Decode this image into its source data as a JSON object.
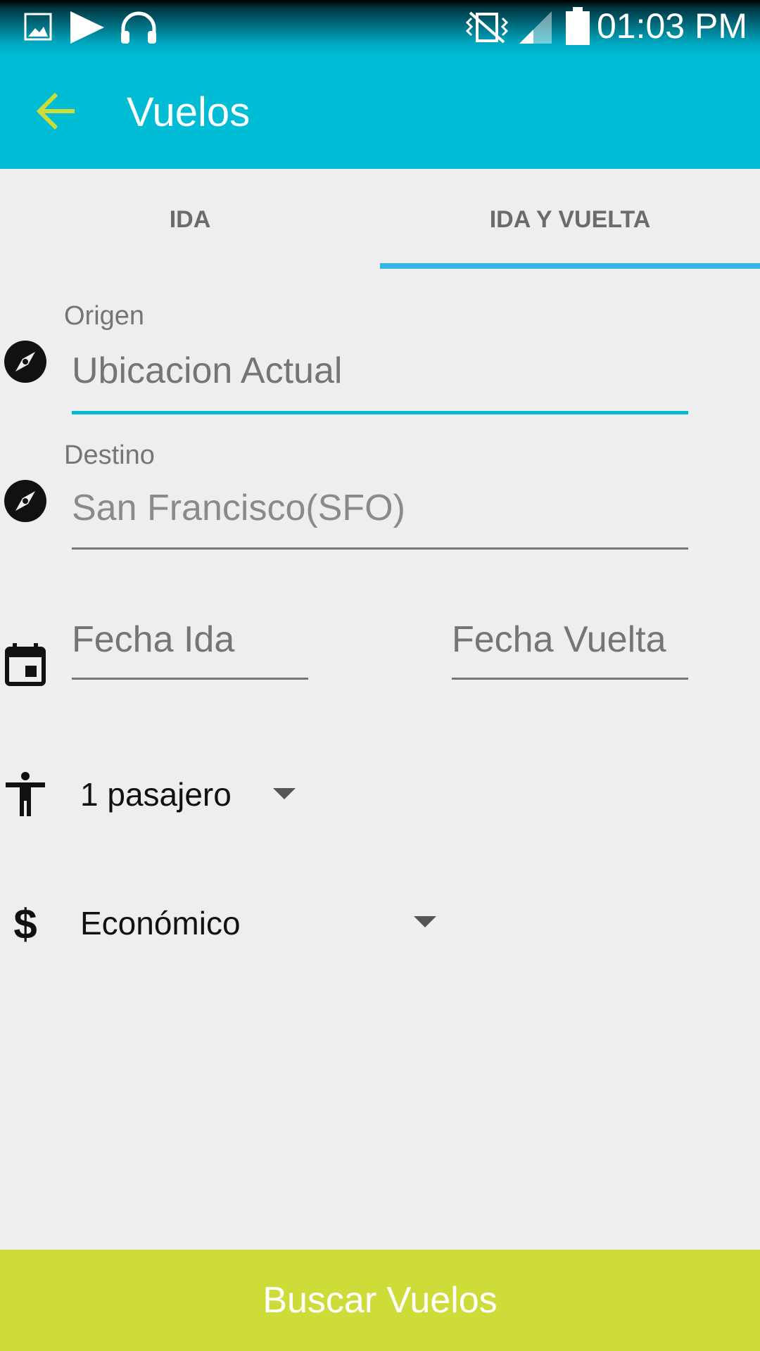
{
  "status_bar": {
    "time": "01:03 PM",
    "icons": [
      "image-icon",
      "play-icon",
      "headphones-icon",
      "vibrate-icon",
      "signal-icon",
      "battery-icon"
    ]
  },
  "app_bar": {
    "title": "Vuelos",
    "back_icon": "arrow-back-icon",
    "back_color": "#cddc39"
  },
  "tabs": [
    {
      "label": "IDA",
      "selected": false
    },
    {
      "label": "IDA Y VUELTA",
      "selected": true
    }
  ],
  "form": {
    "origin": {
      "label": "Origen",
      "placeholder": "Ubicacion Actual",
      "icon": "compass-icon"
    },
    "destination": {
      "label": "Destino",
      "value": "San Francisco(SFO)",
      "icon": "compass-icon"
    },
    "dates": {
      "departure_placeholder": "Fecha Ida",
      "return_placeholder": "Fecha Vuelta",
      "icon": "calendar-icon"
    },
    "passengers": {
      "value": "1 pasajero",
      "icon": "person-icon"
    },
    "class": {
      "value": "Económico",
      "icon": "dollar-icon"
    }
  },
  "cta": {
    "label": "Buscar Vuelos"
  },
  "colors": {
    "primary": "#00bcd4",
    "accent": "#cddc39",
    "tab_indicator": "#33b5e5"
  }
}
